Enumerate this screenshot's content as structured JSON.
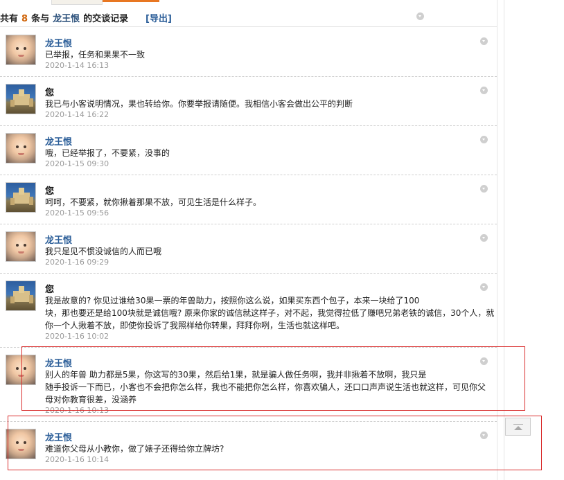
{
  "header": {
    "prefix": "共有",
    "count": "8",
    "middle": "条与",
    "partner": "龙王恨",
    "suffix": "的交谈记录",
    "export_label": "[导出]"
  },
  "messages": [
    {
      "sender": "龙王恨",
      "lines": [
        "已举报，任务和果果不一致"
      ],
      "time": "2020-1-14 16:13"
    },
    {
      "sender": "您",
      "lines": [
        "我已与小客说明情况，果也转给你。你要举报请随便。我相信小客会做出公平的判断"
      ],
      "time": "2020-1-14 16:22"
    },
    {
      "sender": "龙王恨",
      "lines": [
        "哦，已经举报了，不要紧，没事的"
      ],
      "time": "2020-1-15 09:30"
    },
    {
      "sender": "您",
      "lines": [
        "呵呵，不要紧，就你揪着那果不放，可见生活是什么样子。"
      ],
      "time": "2020-1-15 09:56"
    },
    {
      "sender": "龙王恨",
      "lines": [
        "我只是见不惯没诚信的人而已哦"
      ],
      "time": "2020-1-16 09:29"
    },
    {
      "sender": "您",
      "lines": [
        "我是故意的? 你见过谁给30果一票的年兽助力，按照你这么说，如果买东西个包子，本来一块给了100",
        "块，那也要还是给100块就是诚信哦? 原来你家的诚信就这样子，对不起，我觉得拉低了赚吧兄弟老铁的诚信，30个人，就",
        "你一个人揪着不放，即使你投诉了我照样给你转果，拜拜你咧，生活也就这样吧。"
      ],
      "time": "2020-1-16 10:02"
    },
    {
      "sender": "龙王恨",
      "lines": [
        "别人的年兽 助力都是5果，你这写的30果，然后给1果，就是骗人做任务啊，我并非揪着不放啊，我只是",
        "随手投诉一下而已，小客也不会把你怎么样，我也不能把你怎么样，你喜欢骗人，还口口声声说生活也就这样，可见你父",
        "母对你教育很差，没涵养"
      ],
      "time": "2020-1-16 10:13"
    },
    {
      "sender": "龙王恨",
      "lines": [
        "难道你父母从小教你，做了婊子还得给你立牌坊?"
      ],
      "time": "2020-1-16 10:14"
    }
  ]
}
